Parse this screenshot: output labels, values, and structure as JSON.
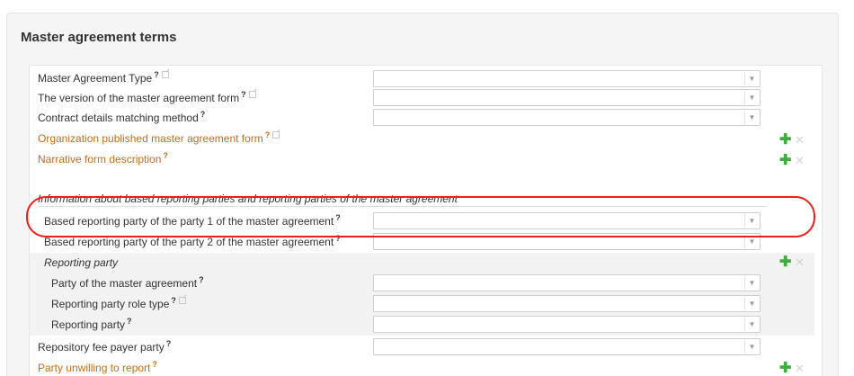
{
  "section": {
    "title": "Master agreement terms"
  },
  "help_mark": "?",
  "plus_glyph": "✚",
  "cross_glyph": "✕",
  "arrow_glyph": "▼",
  "rows": {
    "master_type": {
      "label": "Master Agreement Type"
    },
    "version": {
      "label": "The version of the master agreement form"
    },
    "matching": {
      "label": "Contract details matching method"
    },
    "org_published": {
      "label": "Organization published master agreement form"
    },
    "narrative": {
      "label": "Narrative form description"
    },
    "info_heading": {
      "label": "Information about based reporting parties and reporting parties of the master agreement"
    },
    "based_party1": {
      "label": "Based reporting party of the party 1 of the master agreement"
    },
    "based_party2": {
      "label": "Based reporting party of the party 2 of the master agreement"
    },
    "reporting_party_group": {
      "label": "Reporting party"
    },
    "party_of_master": {
      "label": "Party of the master agreement"
    },
    "role_type": {
      "label": "Reporting party role type"
    },
    "reporting_party": {
      "label": "Reporting party"
    },
    "fee_payer": {
      "label": "Repository fee payer party"
    },
    "unwilling": {
      "label": "Party unwilling to report"
    }
  },
  "colors": {
    "orange_label": "#b8711e",
    "plus_green": "#3fae3f",
    "highlight_red": "#e8201c"
  },
  "icons": {
    "external": "external-link-icon",
    "add": "plus-icon",
    "remove": "close-icon",
    "dropdown": "chevron-down-icon"
  }
}
